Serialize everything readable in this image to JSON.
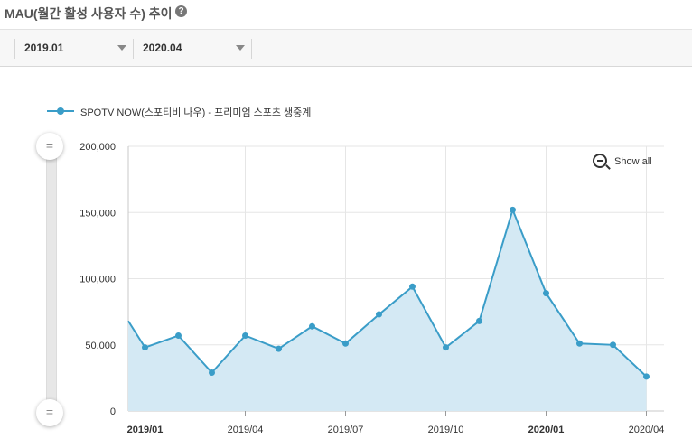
{
  "header": {
    "title": "MAU(월간 활성 사용자 수) 추이",
    "help_icon": "help-circle-icon"
  },
  "filters": {
    "start": "2019.01",
    "end": "2020.04"
  },
  "legend": {
    "label": "SPOTV NOW(스포티비 나우) - 프리미엄 스포츠 생중계"
  },
  "zoom": {
    "label": "Show all",
    "icon": "zoom-out-icon"
  },
  "colors": {
    "line": "#3a9dc8",
    "area": "#d4e9f4",
    "grid": "#e6e6e6",
    "axis": "#333333"
  },
  "chart_data": {
    "type": "area",
    "title": "",
    "xlabel": "",
    "ylabel": "",
    "ylim": [
      0,
      200000
    ],
    "yticks": [
      "0",
      "50,000",
      "100,000",
      "150,000",
      "200,000"
    ],
    "xticks": [
      {
        "label": "2019/01",
        "bold": true
      },
      {
        "label": "2019/04",
        "bold": false
      },
      {
        "label": "2019/07",
        "bold": false
      },
      {
        "label": "2019/10",
        "bold": false
      },
      {
        "label": "2020/01",
        "bold": true
      },
      {
        "label": "2020/04",
        "bold": false
      }
    ],
    "grid": true,
    "legend_position": "top-left",
    "series": [
      {
        "name": "SPOTV NOW(스포티비 나우) - 프리미엄 스포츠 생중계",
        "x": [
          "2018/12",
          "2019/01",
          "2019/02",
          "2019/03",
          "2019/04",
          "2019/05",
          "2019/06",
          "2019/07",
          "2019/08",
          "2019/09",
          "2019/10",
          "2019/11",
          "2019/12",
          "2020/01",
          "2020/02",
          "2020/03",
          "2020/04"
        ],
        "values": [
          68000,
          48000,
          57000,
          29000,
          57000,
          47000,
          64000,
          51000,
          73000,
          94000,
          48000,
          68000,
          152000,
          89000,
          51000,
          50000,
          26000
        ]
      }
    ]
  }
}
